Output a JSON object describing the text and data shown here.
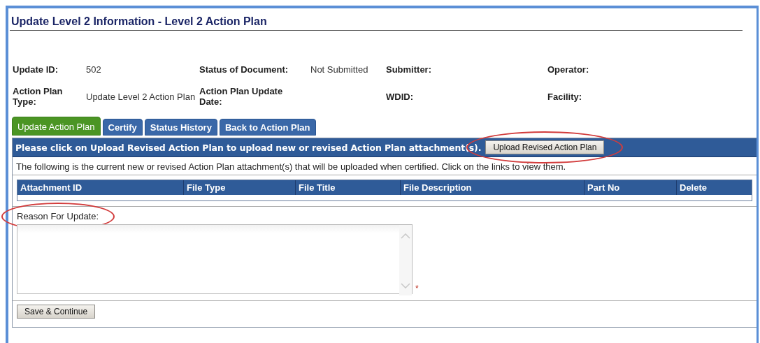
{
  "page_title": "Update Level 2 Information - Level 2 Action Plan",
  "info_rows": [
    [
      {
        "label": "Update ID:",
        "value": "502"
      },
      {
        "label": "Status of Document:",
        "value": "Not Submitted"
      },
      {
        "label": "Submitter:"
      },
      {
        "label": "Operator:"
      }
    ],
    [
      {
        "label": "Action Plan Type:",
        "value": "Update Level 2 Action Plan"
      },
      {
        "label": "Action Plan Update Date:"
      },
      {
        "label": "WDID:"
      },
      {
        "label": "Facility:"
      }
    ]
  ],
  "tabs": [
    {
      "label": "Update Action Plan",
      "selected": true
    },
    {
      "label": "Certify",
      "selected": false
    },
    {
      "label": "Status History",
      "selected": false
    },
    {
      "label": "Back to Action Plan",
      "selected": false
    }
  ],
  "instruction_bar": {
    "text": "Please click on Upload Revised Action Plan to upload new or revised Action Plan attachment(s).",
    "button": {
      "label": "Upload Revised Action Plan",
      "circled": true
    }
  },
  "note": "The following is the current new or revised Action Plan attachment(s) that will be uploaded when certified. Click on the links to view them.",
  "table": {
    "columns": [
      "Attachment ID",
      "File Type",
      "File Title",
      "File Description",
      "Part No",
      "Delete"
    ]
  },
  "reason": {
    "label": "Reason For Update:",
    "circled": true,
    "required_mark": "*"
  },
  "save_button": {
    "label": "Save & Continue"
  }
}
